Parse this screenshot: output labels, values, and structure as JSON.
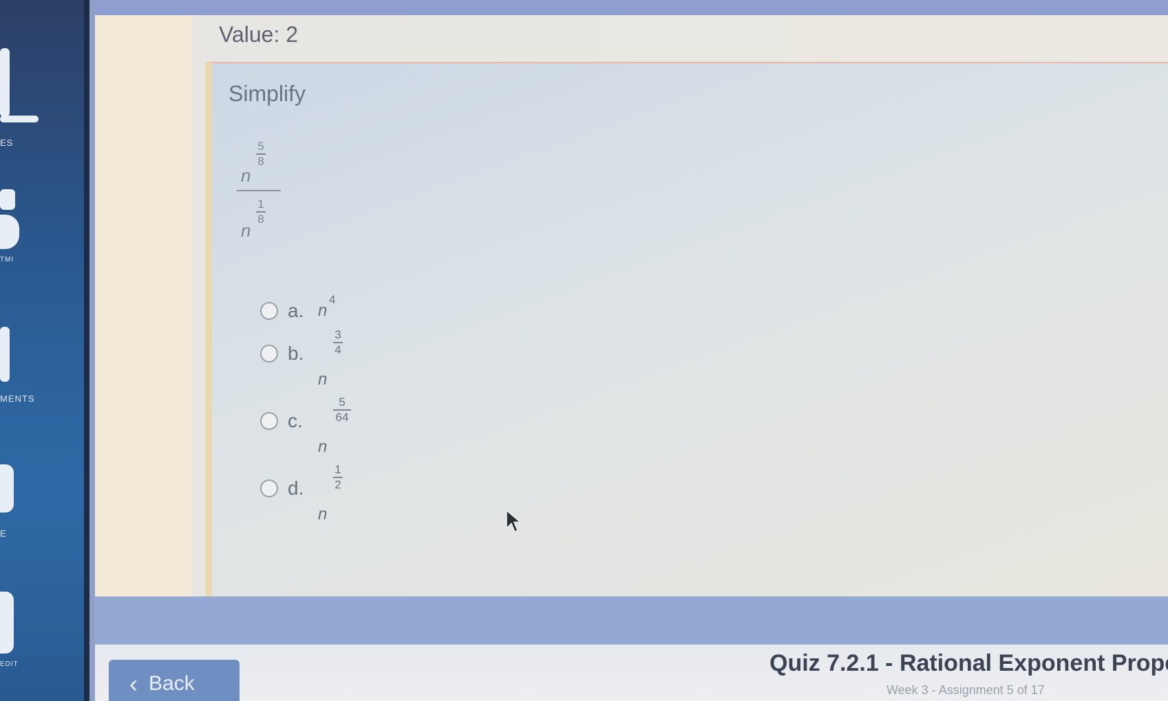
{
  "sidebar": {
    "labels": [
      "ES",
      "TMI",
      "MENTS",
      "E",
      "EDIT"
    ]
  },
  "question": {
    "value_label": "Value: 2",
    "prompt": "Simplify",
    "expression": {
      "numerator_base": "n",
      "numerator_exp_num": "5",
      "numerator_exp_den": "8",
      "denominator_base": "n",
      "denominator_exp_num": "1",
      "denominator_exp_den": "8"
    },
    "options": [
      {
        "letter": "a.",
        "base": "n",
        "exp": "4",
        "exp_num": "",
        "exp_den": ""
      },
      {
        "letter": "b.",
        "base": "n",
        "exp": "",
        "exp_num": "3",
        "exp_den": "4"
      },
      {
        "letter": "c.",
        "base": "n",
        "exp": "",
        "exp_num": "5",
        "exp_den": "64"
      },
      {
        "letter": "d.",
        "base": "n",
        "exp": "",
        "exp_num": "1",
        "exp_den": "2"
      }
    ]
  },
  "footer": {
    "back_label": "Back",
    "quiz_title": "Quiz 7.2.1 - Rational Exponent Prope",
    "quiz_subtitle": "Week 3 - Assignment 5 of 17"
  },
  "icons": {
    "back": "chevron-left-icon",
    "cursor": "mouse-pointer-icon"
  }
}
